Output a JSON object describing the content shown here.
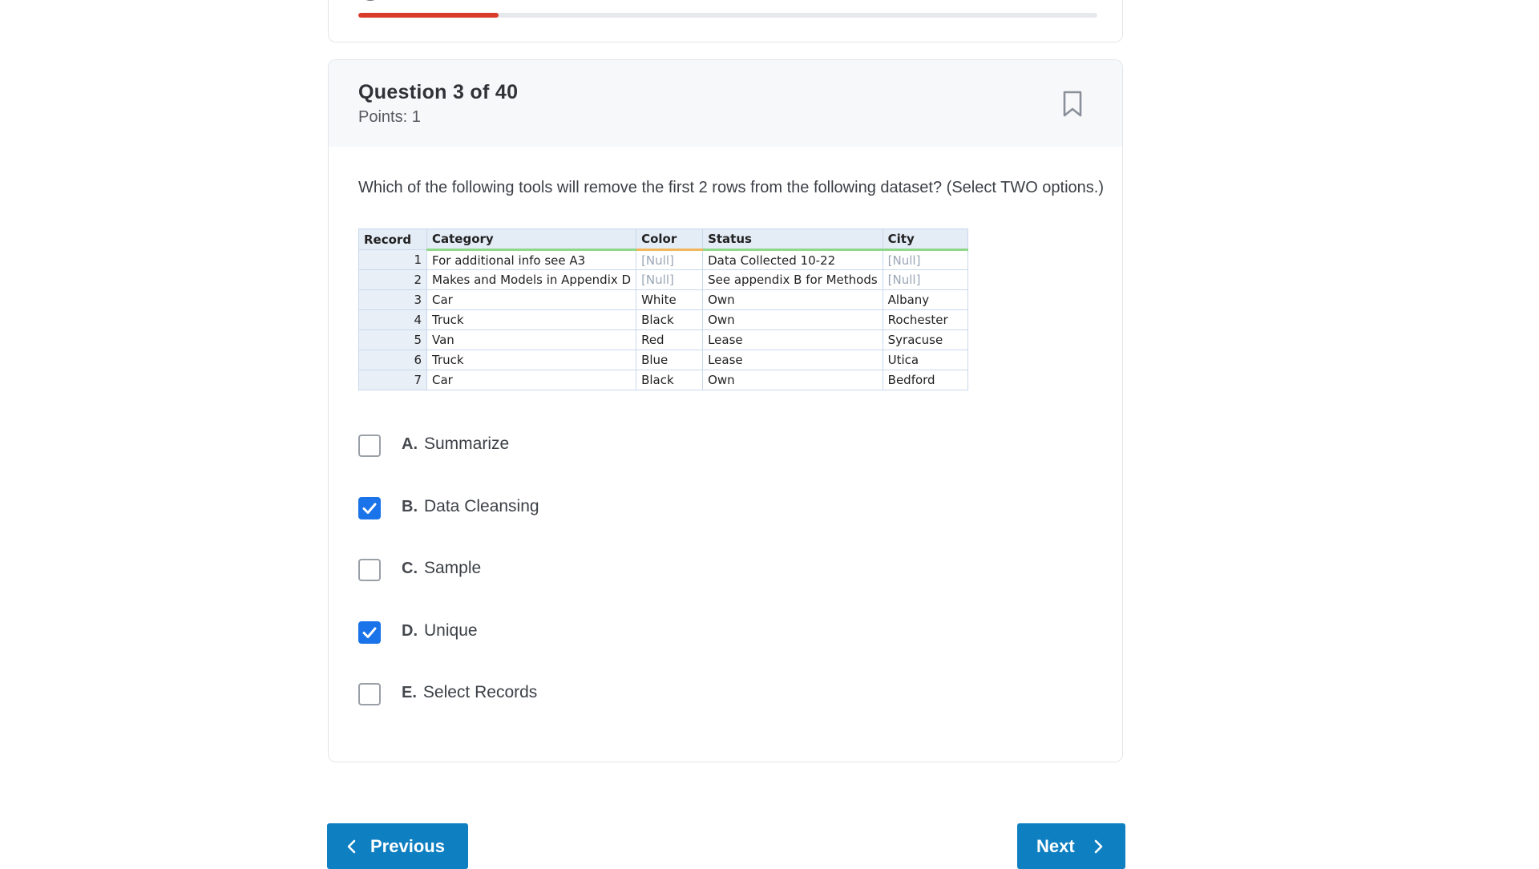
{
  "progress": {
    "value_fraction": 0.19,
    "fill_color": "#d93b2b"
  },
  "question": {
    "title": "Question 3 of 40",
    "points": "Points: 1",
    "text": "Which of the following tools will remove the first 2 rows from the following dataset? (Select TWO options.)"
  },
  "table": {
    "headers": [
      "Record",
      "Category",
      "Color",
      "Status",
      "City"
    ],
    "rows": [
      [
        "1",
        "For additional info see A3",
        "[Null]",
        "Data Collected 10-22",
        "[Null]"
      ],
      [
        "2",
        "Makes and Models in Appendix D",
        "[Null]",
        "See appendix B for Methods",
        "[Null]"
      ],
      [
        "3",
        "Car",
        "White",
        "Own",
        "Albany"
      ],
      [
        "4",
        "Truck",
        "Black",
        "Own",
        "Rochester"
      ],
      [
        "5",
        "Van",
        "Red",
        "Lease",
        "Syracuse"
      ],
      [
        "6",
        "Truck",
        "Blue",
        "Lease",
        "Utica"
      ],
      [
        "7",
        "Car",
        "Black",
        "Own",
        "Bedford"
      ]
    ]
  },
  "options": [
    {
      "letter": "A.",
      "label": "Summarize",
      "checked": false
    },
    {
      "letter": "B.",
      "label": "Data Cleansing",
      "checked": true
    },
    {
      "letter": "C.",
      "label": "Sample",
      "checked": false
    },
    {
      "letter": "D.",
      "label": "Unique",
      "checked": true
    },
    {
      "letter": "E.",
      "label": "Select Records",
      "checked": false
    }
  ],
  "nav": {
    "previous_label": "Previous",
    "next_label": "Next"
  },
  "colors": {
    "primary_button": "#0e7fc1",
    "checkbox_checked": "#1a73e8"
  }
}
